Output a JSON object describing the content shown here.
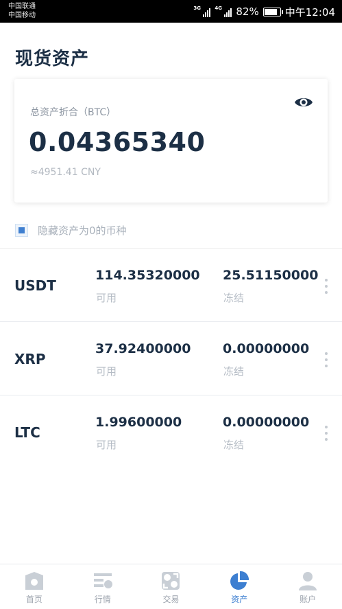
{
  "status_bar": {
    "carrier_1": "中国联通",
    "carrier_2": "中国移动",
    "network_1": "3G",
    "network_2": "4G",
    "battery": "82%",
    "battery_level": 0.82,
    "time": "中午12:04"
  },
  "page": {
    "title": "现货资产"
  },
  "summary": {
    "label": "总资产折合（BTC）",
    "value": "0.04365340",
    "cny": "≈4951.41 CNY",
    "eye_icon": "eye-icon"
  },
  "hide_zero": {
    "label": "隐藏资产为0的币种",
    "checked": true
  },
  "assets": [
    {
      "symbol": "USDT",
      "available": "114.35320000",
      "available_label": "可用",
      "frozen": "25.51150000",
      "frozen_label": "冻结"
    },
    {
      "symbol": "XRP",
      "available": "37.92400000",
      "available_label": "可用",
      "frozen": "0.00000000",
      "frozen_label": "冻结"
    },
    {
      "symbol": "LTC",
      "available": "1.99600000",
      "available_label": "可用",
      "frozen": "0.00000000",
      "frozen_label": "冻结"
    }
  ],
  "bottom_nav": [
    {
      "label": "首页",
      "icon": "home-icon",
      "active": false
    },
    {
      "label": "行情",
      "icon": "market-icon",
      "active": false
    },
    {
      "label": "交易",
      "icon": "trade-icon",
      "active": false
    },
    {
      "label": "资产",
      "icon": "assets-pie-icon",
      "active": true
    },
    {
      "label": "账户",
      "icon": "account-icon",
      "active": false
    }
  ],
  "colors": {
    "primary_text": "#1c2f45",
    "accent": "#3d7fd1",
    "inactive_icon": "#c9cfd6"
  }
}
